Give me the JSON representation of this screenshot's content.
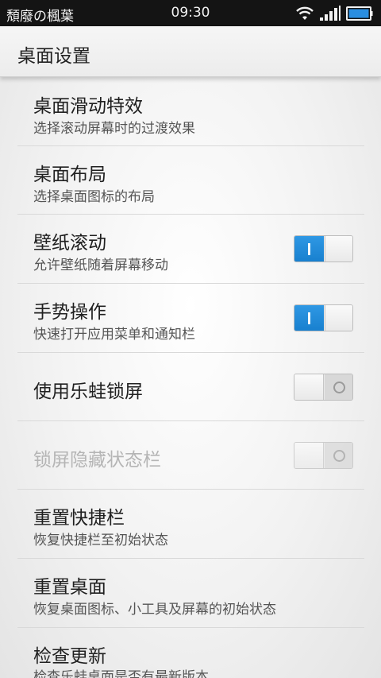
{
  "status_bar": {
    "carrier": "頽廢の楓葉",
    "time": "09:30",
    "icons": [
      "wifi-icon",
      "signal-icon",
      "battery-icon"
    ]
  },
  "header": {
    "title": "桌面设置"
  },
  "settings": [
    {
      "title": "桌面滑动特效",
      "subtitle": "选择滚动屏幕时的过渡效果"
    },
    {
      "title": "桌面布局",
      "subtitle": "选择桌面图标的布局"
    },
    {
      "title": "壁纸滚动",
      "subtitle": "允许壁纸随着屏幕移动",
      "toggle": "on"
    },
    {
      "title": "手势操作",
      "subtitle": "快速打开应用菜单和通知栏",
      "toggle": "on"
    },
    {
      "title": "使用乐蛙锁屏",
      "toggle": "off"
    },
    {
      "title": "锁屏隐藏状态栏",
      "toggle": "off",
      "disabled": true
    },
    {
      "title": "重置快捷栏",
      "subtitle": "恢复快捷栏至初始状态"
    },
    {
      "title": "重置桌面",
      "subtitle": "恢复桌面图标、小工具及屏幕的初始状态"
    },
    {
      "title": "检查更新",
      "subtitle": "检查乐蛙桌面是否有最新版本"
    }
  ],
  "colors": {
    "toggle_on": "#1f88d6",
    "status_bar_bg": "#141414",
    "battery_fill": "#2a8ee0"
  }
}
